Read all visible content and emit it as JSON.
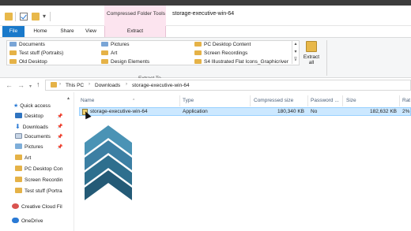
{
  "titlebar": {
    "contextual_tab_header": "Compressed Folder Tools",
    "window_title": "storage-executive-win-64"
  },
  "tabs": {
    "file": "File",
    "home": "Home",
    "share": "Share",
    "view": "View",
    "extract": "Extract"
  },
  "ribbon": {
    "extract_to_items": [
      "Documents",
      "Test stuff (Portraits)",
      "Old Desktop",
      "Pictures",
      "Art",
      "Design Elements",
      "PC Desktop Content",
      "Screen Recordings",
      "S4 Illustrated Flat Icons_Graphicriver"
    ],
    "group_label": "Extract To",
    "extract_all_label_line1": "Extract",
    "extract_all_label_line2": "all"
  },
  "address": {
    "crumbs": [
      "This PC",
      "Downloads",
      "storage-executive-win-64"
    ]
  },
  "nav": {
    "items": [
      {
        "label": "Quick access",
        "icon": "star-icon"
      },
      {
        "label": "Desktop",
        "icon": "desktop-icon",
        "pinned": true
      },
      {
        "label": "Downloads",
        "icon": "download-icon",
        "pinned": true
      },
      {
        "label": "Documents",
        "icon": "documents-icon",
        "pinned": true
      },
      {
        "label": "Pictures",
        "icon": "pictures-icon",
        "pinned": true
      },
      {
        "label": "Art",
        "icon": "folder-icon"
      },
      {
        "label": "PC Desktop Con",
        "icon": "folder-icon"
      },
      {
        "label": "Screen Recordin",
        "icon": "folder-icon"
      },
      {
        "label": "Test stuff (Portra",
        "icon": "folder-icon"
      },
      {
        "label": "Creative Cloud Fil",
        "icon": "creative-cloud-icon"
      },
      {
        "label": "OneDrive",
        "icon": "onedrive-icon"
      }
    ]
  },
  "columns": [
    "Name",
    "Type",
    "Compressed size",
    "Password ...",
    "Size",
    "Rat"
  ],
  "rows": [
    {
      "name": "storage-executive-win-64",
      "type": "Application",
      "compressed_size": "180,340 KB",
      "password": "No",
      "size": "182,632 KB",
      "ratio": "2%"
    }
  ],
  "colors": {
    "accent": "#1979ca",
    "contextual": "#fce4ef",
    "selection": "#cce8ff",
    "logo": "#2e6f8e"
  }
}
